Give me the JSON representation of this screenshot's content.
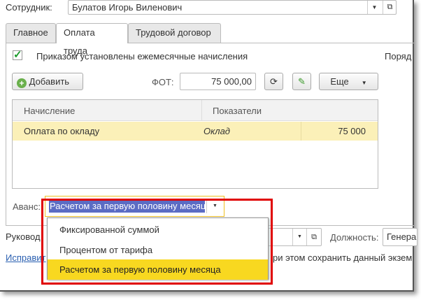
{
  "employee": {
    "label": "Сотрудник:",
    "value": "Булатов Игорь Виленович"
  },
  "tabs": [
    {
      "label": "Главное"
    },
    {
      "label": "Оплата труда"
    },
    {
      "label": "Трудовой договор"
    }
  ],
  "checkbox": {
    "label": "Приказом установлены ежемесячные начисления",
    "checked": true
  },
  "right_cut_label": "Поряд",
  "toolbar": {
    "add": "Добавить",
    "fot_label": "ФОТ:",
    "fot_value": "75 000,00",
    "more": "Еще"
  },
  "table": {
    "headers": [
      "Начисление",
      "Показатели"
    ],
    "rows": [
      {
        "name": "Оплата по окладу",
        "indicator": "Оклад",
        "value": "75 000"
      }
    ]
  },
  "advance": {
    "label": "Аванс:",
    "value": "Расчетом за первую половину месяц",
    "options": [
      "Фиксированной суммой",
      "Процентом от тарифа",
      "Расчетом за первую половину месяца"
    ],
    "selected_index": 2
  },
  "manager_label": "Руковод",
  "position": {
    "label": "Должность:",
    "value": "Генера"
  },
  "link": "Исправит",
  "link_tail": "ри этом сохранить данный экзем",
  "colors": {
    "highlight": "#f8d820",
    "row": "#fbf0b8",
    "selection": "#5b6cc4",
    "annotation": "#e00000"
  }
}
